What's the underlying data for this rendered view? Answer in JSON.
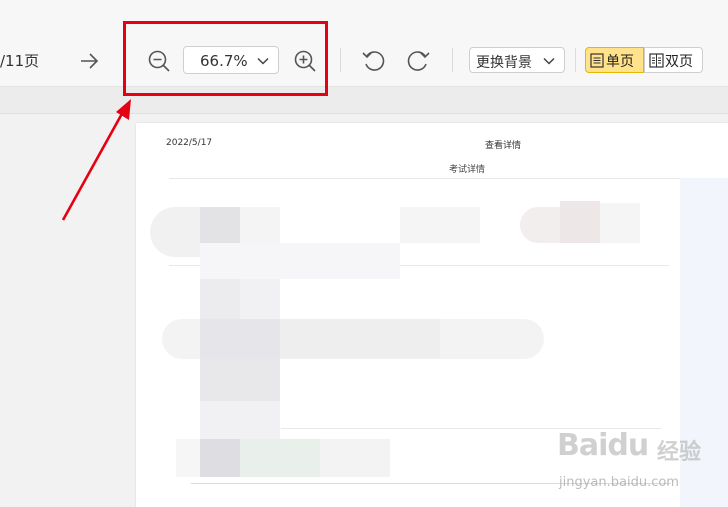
{
  "toolbar": {
    "page_count": "/11页",
    "zoom_value": "66.7%",
    "background_label": "更换背景",
    "single_page_label": "单页",
    "double_page_label": "双页"
  },
  "document": {
    "date": "2022/5/17",
    "header_title": "查看详情",
    "subtitle": "考试详情"
  },
  "watermark": {
    "logo_text": "Baidu",
    "logo_cn": "经验",
    "url": "jingyan.baidu.com"
  },
  "colors": {
    "highlight": "#e60012",
    "active_toggle": "#ffe28a"
  }
}
